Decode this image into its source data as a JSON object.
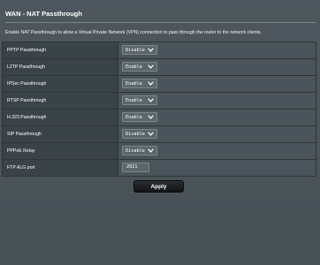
{
  "page": {
    "title": "WAN - NAT Passthrough",
    "description": "Enable NAT Passthrough to allow a Virtual Private Network (VPN) connection to pass through the router to the network clients."
  },
  "settings": [
    {
      "label": "PPTP Passthrough",
      "value": "Disable"
    },
    {
      "label": "L2TP Passthrough",
      "value": "Enable"
    },
    {
      "label": "IPSec Passthrough",
      "value": "Enable"
    },
    {
      "label": "RTSP Passthrough",
      "value": "Enable"
    },
    {
      "label": "H.323 Passthrough",
      "value": "Enable"
    },
    {
      "label": "SIP Passthrough",
      "value": "Disable"
    },
    {
      "label": "PPPoE Relay",
      "value": "Disable"
    }
  ],
  "ftp_alg": {
    "label": "FTP ALG port",
    "value": "2021"
  },
  "actions": {
    "apply_label": "Apply"
  },
  "icons": {
    "dropdown": "chevron-down-icon"
  },
  "colors": {
    "background": "#4a545a",
    "label_cell": "#3a4348",
    "apply_button": "#1c1f21"
  }
}
